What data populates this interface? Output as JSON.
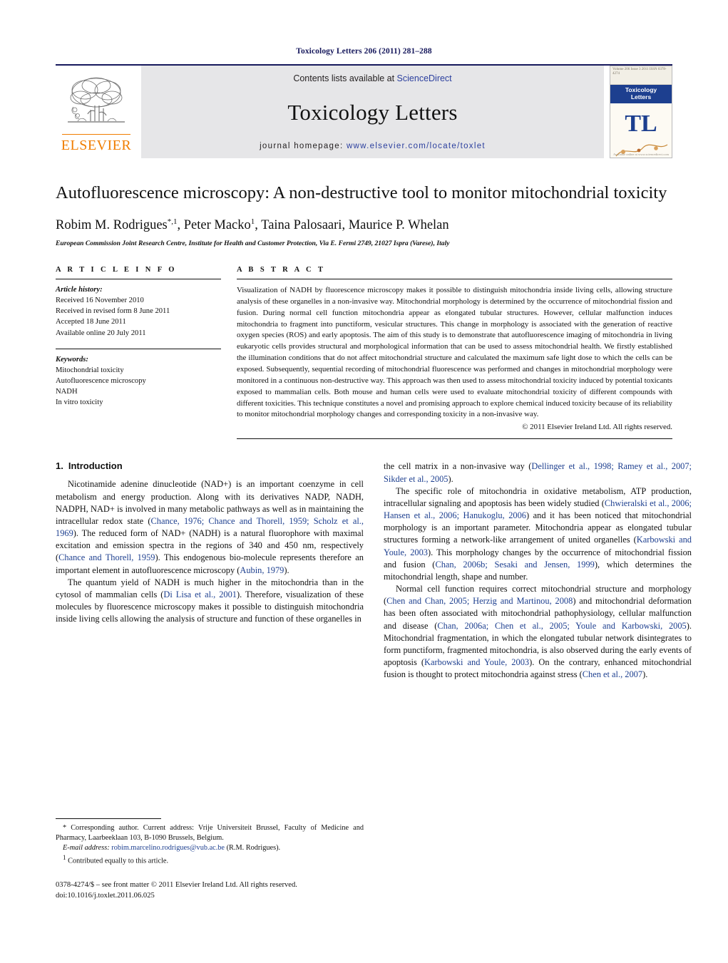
{
  "running_head": "Toxicology Letters 206 (2011) 281–288",
  "masthead": {
    "publisher": "ELSEVIER",
    "contents_prefix": "Contents lists available at ",
    "contents_link": "ScienceDirect",
    "journal_name": "Toxicology Letters",
    "homepage_label": "journal homepage:",
    "homepage_url": "www.elsevier.com/locate/toxlet",
    "cover": {
      "band_line1": "Toxicology",
      "band_line2": "Letters",
      "monogram": "TL",
      "top_note": "Volume 206  Issue 3  2011  ISSN 0378-4274",
      "foot_note": "Available online at www.sciencedirect.com"
    }
  },
  "article": {
    "title": "Autofluorescence microscopy: A non-destructive tool to monitor mitochondrial toxicity",
    "authors": "Robim M. Rodrigues*,1, Peter Macko1, Taina Palosaari, Maurice P. Whelan",
    "affiliation": "European Commission Joint Research Centre, Institute for Health and Customer Protection, Via E. Fermi 2749, 21027 Ispra (Varese), Italy"
  },
  "article_info": {
    "heading": "A R T I C L E    I N F O",
    "history_label": "Article history:",
    "history": [
      "Received 16 November 2010",
      "Received in revised form 8 June 2011",
      "Accepted 18 June 2011",
      "Available online 20 July 2011"
    ],
    "keywords_label": "Keywords:",
    "keywords": [
      "Mitochondrial toxicity",
      "Autofluorescence microscopy",
      "NADH",
      "In vitro toxicity"
    ]
  },
  "abstract": {
    "heading": "A B S T R A C T",
    "text": "Visualization of NADH by fluorescence microscopy makes it possible to distinguish mitochondria inside living cells, allowing structure analysis of these organelles in a non-invasive way. Mitochondrial morphology is determined by the occurrence of mitochondrial fission and fusion. During normal cell function mitochondria appear as elongated tubular structures. However, cellular malfunction induces mitochondria to fragment into punctiform, vesicular structures. This change in morphology is associated with the generation of reactive oxygen species (ROS) and early apoptosis. The aim of this study is to demonstrate that autofluorescence imaging of mitochondria in living eukaryotic cells provides structural and morphological information that can be used to assess mitochondrial health. We firstly established the illumination conditions that do not affect mitochondrial structure and calculated the maximum safe light dose to which the cells can be exposed. Subsequently, sequential recording of mitochondrial fluorescence was performed and changes in mitochondrial morphology were monitored in a continuous non-destructive way. This approach was then used to assess mitochondrial toxicity induced by potential toxicants exposed to mammalian cells. Both mouse and human cells were used to evaluate mitochondrial toxicity of different compounds with different toxicities. This technique constitutes a novel and promising approach to explore chemical induced toxicity because of its reliability to monitor mitochondrial morphology changes and corresponding toxicity in a non-invasive way.",
    "copyright": "© 2011 Elsevier Ireland Ltd. All rights reserved."
  },
  "introduction": {
    "number": "1.",
    "heading": "Introduction",
    "left_paragraphs": [
      {
        "segments": [
          {
            "t": "Nicotinamide adenine dinucleotide (NAD+) is an important coenzyme in cell metabolism and energy production. Along with its derivatives NADP, NADH, NADPH, NAD+ is involved in many metabolic pathways as well as in maintaining the intracellular redox state (",
            "c": false
          },
          {
            "t": "Chance, 1976; Chance and Thorell, 1959; Scholz et al., 1969",
            "c": true
          },
          {
            "t": "). The reduced form of NAD+ (NADH) is a natural fluorophore with maximal excitation and emission spectra in the regions of 340 and 450 nm, respectively (",
            "c": false
          },
          {
            "t": "Chance and Thorell, 1959",
            "c": true
          },
          {
            "t": "). This endogenous bio-molecule represents therefore an important element in autofluorescence microscopy (",
            "c": false
          },
          {
            "t": "Aubin, 1979",
            "c": true
          },
          {
            "t": ").",
            "c": false
          }
        ]
      },
      {
        "segments": [
          {
            "t": "The quantum yield of NADH is much higher in the mitochondria than in the cytosol of mammalian cells (",
            "c": false
          },
          {
            "t": "Di Lisa et al., 2001",
            "c": true
          },
          {
            "t": "). Therefore, visualization of these molecules by fluorescence microscopy makes it possible to distinguish mitochondria inside living cells allowing the analysis of structure and function of these organelles in",
            "c": false
          }
        ]
      }
    ],
    "right_paragraphs": [
      {
        "continuation": true,
        "segments": [
          {
            "t": "the cell matrix in a non-invasive way (",
            "c": false
          },
          {
            "t": "Dellinger et al., 1998; Ramey et al., 2007; Sikder et al., 2005",
            "c": true
          },
          {
            "t": ").",
            "c": false
          }
        ]
      },
      {
        "segments": [
          {
            "t": "The specific role of mitochondria in oxidative metabolism, ATP production, intracellular signaling and apoptosis has been widely studied (",
            "c": false
          },
          {
            "t": "Chwieralski et al., 2006; Hansen et al., 2006; Hanukoglu, 2006",
            "c": true
          },
          {
            "t": ") and it has been noticed that mitochondrial morphology is an important parameter. Mitochondria appear as elongated tubular structures forming a network-like arrangement of united organelles (",
            "c": false
          },
          {
            "t": "Karbowski and Youle, 2003",
            "c": true
          },
          {
            "t": "). This morphology changes by the occurrence of mitochondrial fission and fusion (",
            "c": false
          },
          {
            "t": "Chan, 2006b; Sesaki and Jensen, 1999",
            "c": true
          },
          {
            "t": "), which determines the mitochondrial length, shape and number.",
            "c": false
          }
        ]
      },
      {
        "segments": [
          {
            "t": "Normal cell function requires correct mitochondrial structure and morphology (",
            "c": false
          },
          {
            "t": "Chen and Chan, 2005; Herzig and Martinou, 2008",
            "c": true
          },
          {
            "t": ") and mitochondrial deformation has been often associated with mitochondrial pathophysiology, cellular malfunction and disease (",
            "c": false
          },
          {
            "t": "Chan, 2006a; Chen et al., 2005; Youle and Karbowski, 2005",
            "c": true
          },
          {
            "t": "). Mitochondrial fragmentation, in which the elongated tubular network disintegrates to form punctiform, fragmented mitochondria, is also observed during the early events of apoptosis (",
            "c": false
          },
          {
            "t": "Karbowski and Youle, 2003",
            "c": true
          },
          {
            "t": "). On the contrary, enhanced mitochondrial fusion is thought to protect mitochondria against stress (",
            "c": false
          },
          {
            "t": "Chen et al., 2007",
            "c": true
          },
          {
            "t": ").",
            "c": false
          }
        ]
      }
    ]
  },
  "footnotes": {
    "corresponding": "* Corresponding author. Current address: Vrije Universiteit Brussel, Faculty of Medicine and Pharmacy, Laarbeeklaan 103, B-1090 Brussels, Belgium.",
    "email_label": "E-mail address:",
    "email": "robim.marcelino.rodrigues@vub.ac.be",
    "email_suffix": "(R.M. Rodrigues).",
    "equal_mark": "1",
    "equal_contrib": "Contributed equally to this article.",
    "issn_line": "0378-4274/$ – see front matter © 2011 Elsevier Ireland Ltd. All rights reserved.",
    "doi_line": "doi:10.1016/j.toxlet.2011.06.025"
  },
  "colors": {
    "nav_blue": "#16185c",
    "link_blue": "#2b3f9e",
    "citation_blue": "#1d3f8f",
    "elsevier_orange": "#f07d00"
  }
}
